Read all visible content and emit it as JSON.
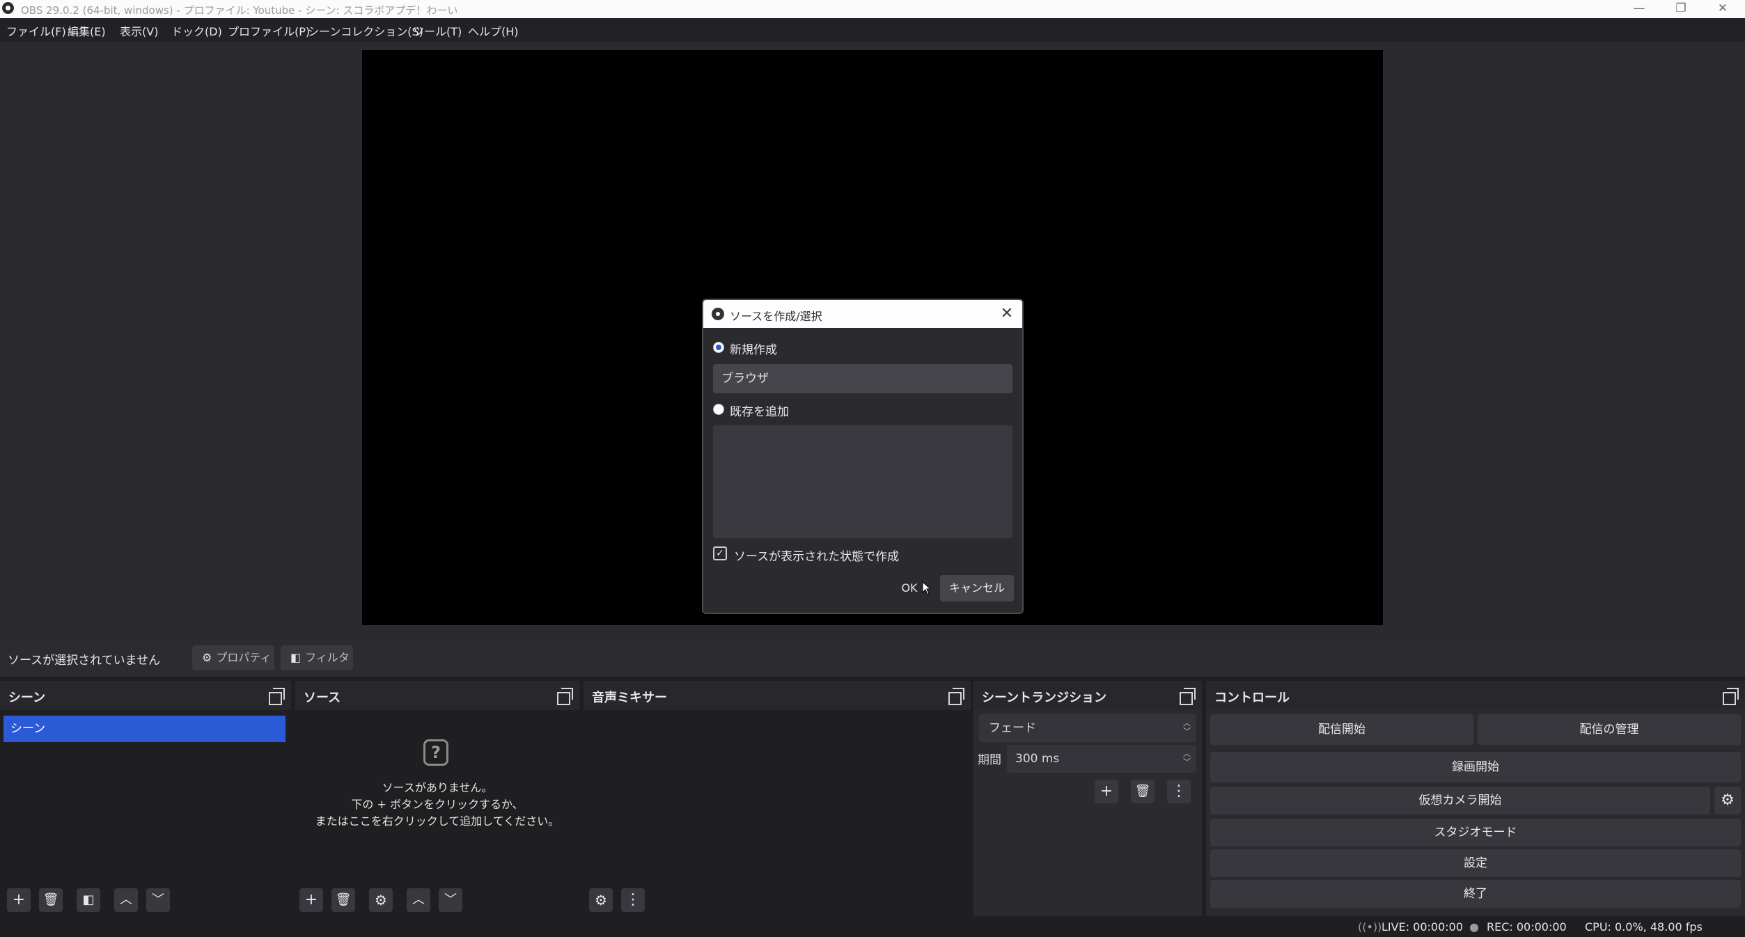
{
  "window": {
    "title": "OBS 29.0.2 (64-bit, windows) - プロファイル: Youtube - シーン: スコラボアプデ！わーい",
    "minimize": "—",
    "restore": "❐",
    "close": "✕"
  },
  "menu": [
    "ファイル(F)",
    "編集(E)",
    "表示(V)",
    "ドック(D)",
    "プロファイル(P)",
    "シーンコレクション(S)",
    "ツール(T)",
    "ヘルプ(H)"
  ],
  "source_toolbar": {
    "status": "ソースが選択されていません",
    "properties_label": "プロパティ",
    "filters_label": "フィルタ"
  },
  "docks": {
    "scenes": {
      "title": "シーン",
      "items": [
        "シーン"
      ]
    },
    "sources": {
      "title": "ソース",
      "empty_icon": "?",
      "empty_line1": "ソースがありません。",
      "empty_line2": "下の + ボタンをクリックするか、",
      "empty_line3": "またはここを右クリックして追加してください。"
    },
    "mixer": {
      "title": "音声ミキサー"
    },
    "transitions": {
      "title": "シーントランジション",
      "selected": "フェード",
      "duration_label": "期間",
      "duration_value": "300 ms"
    },
    "controls": {
      "title": "コントロール",
      "start_streaming": "配信開始",
      "manage_broadcast": "配信の管理",
      "start_recording": "録画開始",
      "start_virtual_camera": "仮想カメラ開始",
      "studio_mode": "スタジオモード",
      "settings": "設定",
      "exit": "終了"
    }
  },
  "statusbar": {
    "live": "LIVE: 00:00:00",
    "rec": "REC: 00:00:00",
    "cpu": "CPU: 0.0%, 48.00 fps"
  },
  "dialog": {
    "title": "ソースを作成/選択",
    "create_new_label": "新規作成",
    "name_value": "ブラウザ",
    "add_existing_label": "既存を追加",
    "visible_label": "ソースが表示された状態で作成",
    "ok_label": "OK",
    "cancel_label": "キャンセル",
    "create_new_selected": true,
    "visible_checked": true
  },
  "icons": {
    "add": "+",
    "remove": "🗑",
    "filter": "◧",
    "up": "︿",
    "down": "﹀",
    "gear": "⚙",
    "more": "⋮",
    "check": "✓",
    "close": "✕"
  },
  "colors": {
    "accent": "#2a5ad6",
    "background": "#1f1e21",
    "panel": "#2b2a2e"
  }
}
